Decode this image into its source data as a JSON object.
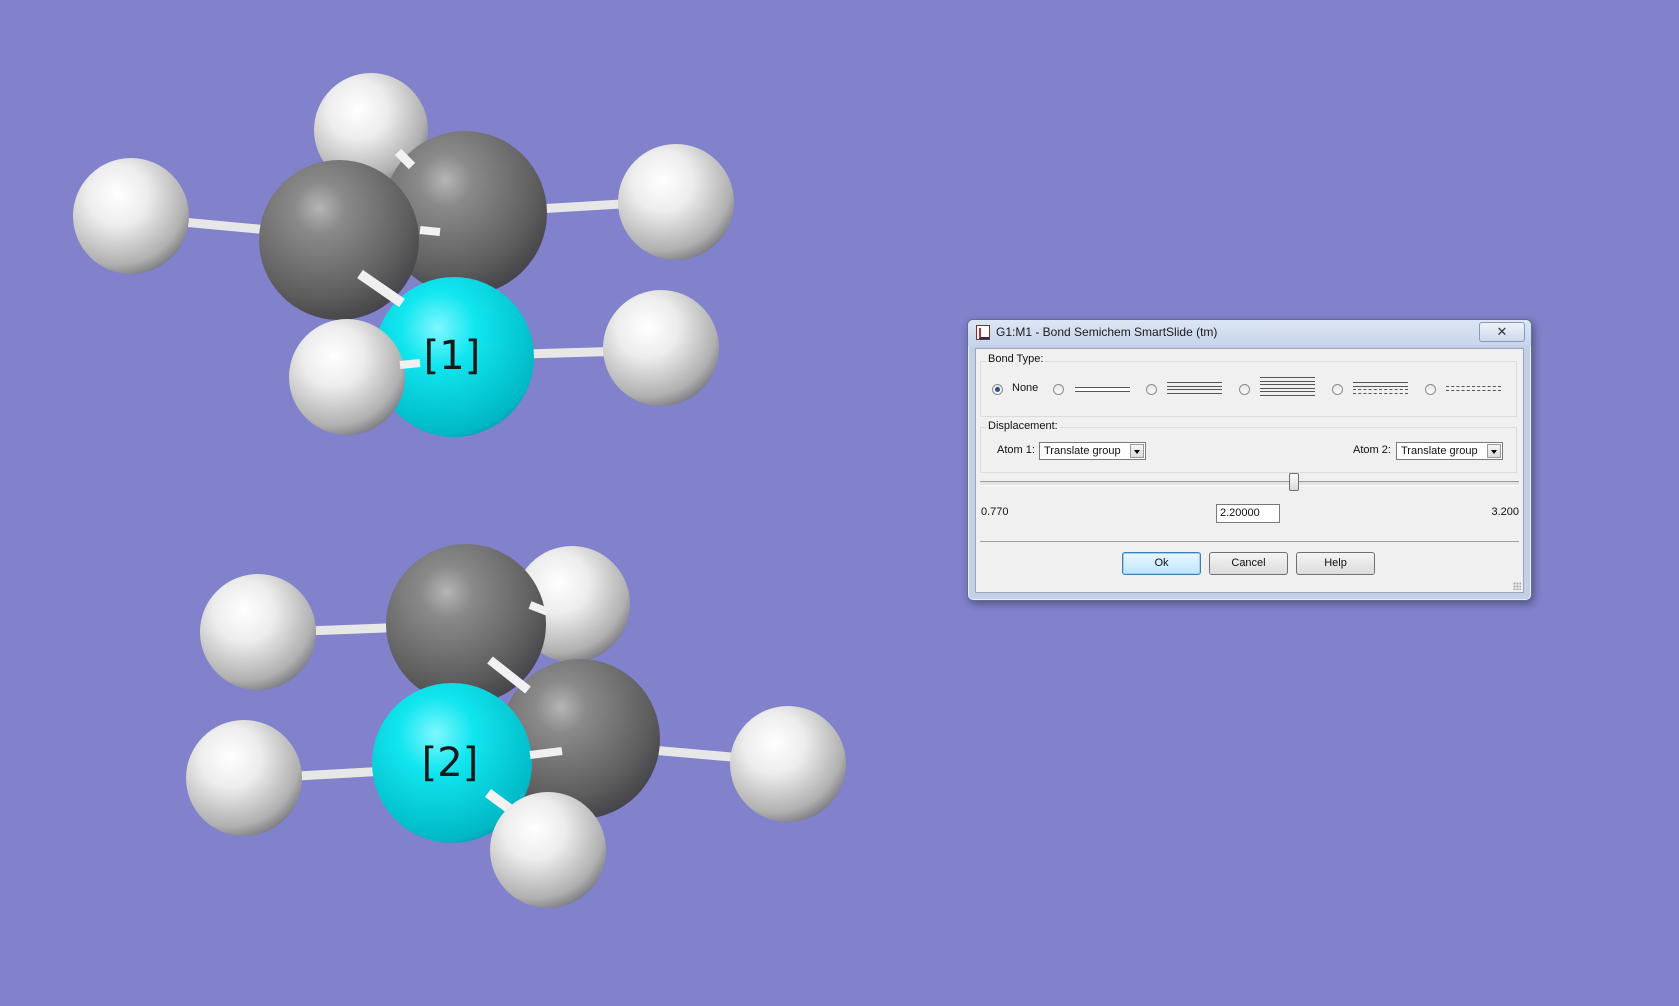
{
  "molecules": [
    {
      "label": "[1]"
    },
    {
      "label": "[2]"
    }
  ],
  "colors": {
    "background": "#8181cc",
    "hetero_atom": "#00e5ee",
    "carbon": "#6d6d6d",
    "hydrogen": "#e8e8e8",
    "bond": "#eeeeee"
  },
  "dialog": {
    "title": "G1:M1 - Bond Semichem SmartSlide (tm)",
    "close_glyph": "✕",
    "bond_type": {
      "label": "Bond Type:",
      "options": [
        {
          "label": "None",
          "icon": "none",
          "selected": true
        },
        {
          "label": "",
          "icon": "single-bond-icon",
          "selected": false
        },
        {
          "label": "",
          "icon": "double-bond-icon",
          "selected": false
        },
        {
          "label": "",
          "icon": "triple-bond-icon",
          "selected": false
        },
        {
          "label": "",
          "icon": "aromatic-bond-icon",
          "selected": false
        },
        {
          "label": "",
          "icon": "partial-bond-icon",
          "selected": false
        }
      ]
    },
    "displacement": {
      "label": "Displacement:",
      "atom1_label": "Atom 1:",
      "atom1_value": "Translate group",
      "atom2_label": "Atom 2:",
      "atom2_value": "Translate group"
    },
    "slider": {
      "min_label": "0.770",
      "max_label": "3.200",
      "value": "2.20000",
      "min": 0.77,
      "max": 3.2,
      "position_value": 2.2
    },
    "buttons": {
      "ok": "Ok",
      "cancel": "Cancel",
      "help": "Help"
    }
  }
}
